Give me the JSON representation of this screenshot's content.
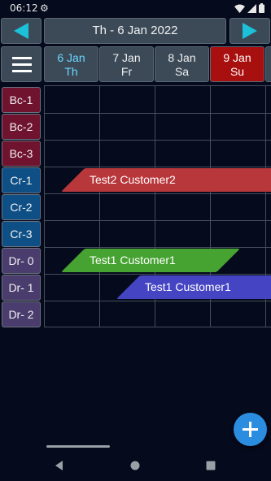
{
  "status_bar": {
    "time": "06:12"
  },
  "header": {
    "current_date": "Th - 6 Jan 2022"
  },
  "days": [
    {
      "date": "6 Jan",
      "weekday": "Th"
    },
    {
      "date": "7 Jan",
      "weekday": "Fr"
    },
    {
      "date": "8 Jan",
      "weekday": "Sa"
    },
    {
      "date": "9 Jan",
      "weekday": "Su"
    }
  ],
  "rooms": [
    {
      "name": "Bc-1",
      "color": "#70132e"
    },
    {
      "name": "Bc-2",
      "color": "#70132e"
    },
    {
      "name": "Bc-3",
      "color": "#70132e"
    },
    {
      "name": "Cr-1",
      "color": "#0e4f86"
    },
    {
      "name": "Cr-2",
      "color": "#0e4f86"
    },
    {
      "name": "Cr-3",
      "color": "#0e4f86"
    },
    {
      "name": "Dr- 0",
      "color": "#4a3d6e"
    },
    {
      "name": "Dr- 1",
      "color": "#4a3d6e"
    },
    {
      "name": "Dr- 2",
      "color": "#4a3d6e"
    }
  ],
  "bookings": [
    {
      "label": "Test2 Customer2",
      "room": "Cr-1",
      "color": "#b8373b"
    },
    {
      "label": "Test1 Customer1",
      "room": "Dr- 0",
      "color": "#46a332"
    },
    {
      "label": "Test1 Customer1",
      "room": "Dr- 1",
      "color": "#4545c4"
    }
  ],
  "colors": {
    "today": "#6ad8ff",
    "sunday": "#a80f0f",
    "accent": "#1cc0d8",
    "fab": "#2b8de0"
  }
}
